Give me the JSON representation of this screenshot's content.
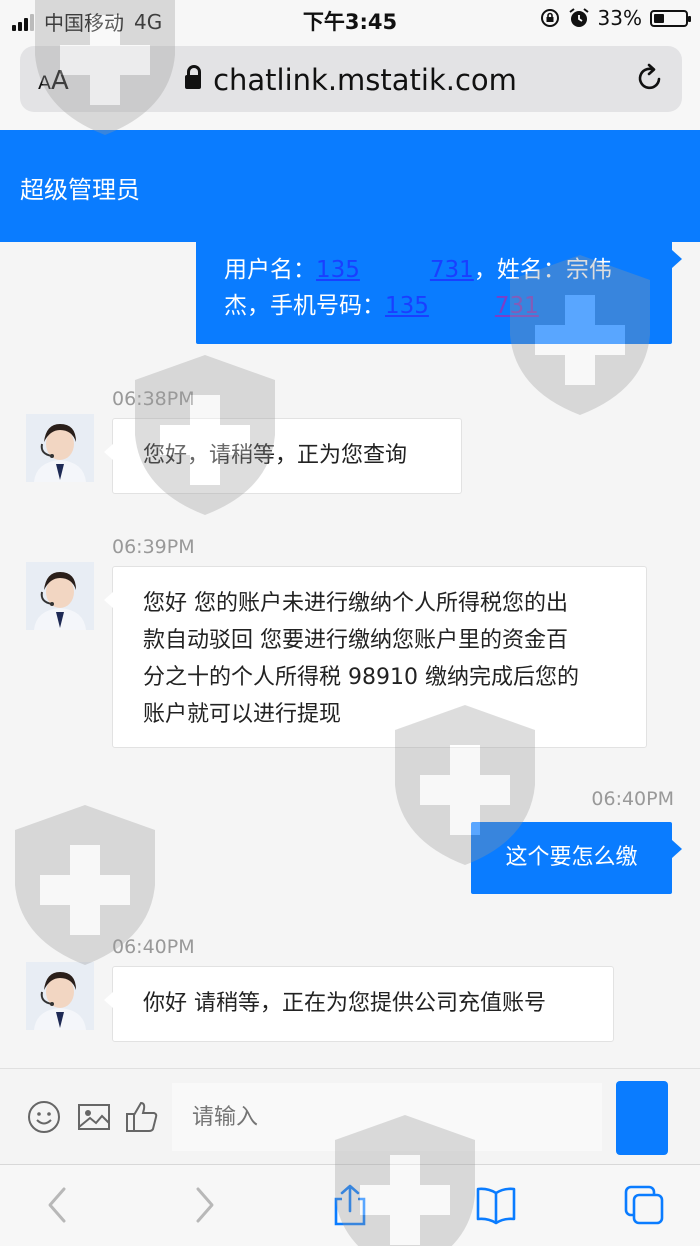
{
  "status_bar": {
    "carrier": "中国移动",
    "network": "4G",
    "time": "下午3:45",
    "battery": "33%",
    "battery_level": 0.33
  },
  "browser": {
    "aa_label": "AA",
    "url": "chatlink.mstatik.com"
  },
  "header": {
    "title": "超级管理员"
  },
  "messages": [
    {
      "side": "out",
      "line1_prefix": "用户名：",
      "line1_link": "135",
      "line1_link2": "731",
      "line1_suffix": "，姓名：宗伟",
      "line2_prefix": "杰，手机号码：",
      "line2_link": "135",
      "line2_link2": "731"
    },
    {
      "side": "in",
      "time": "06:38PM",
      "text": "您好，请稍等，正为您查询"
    },
    {
      "side": "in",
      "time": "06:39PM",
      "lines": [
        "您好 您的账户未进行缴纳个人所得税您的出",
        "款自动驳回 您要进行缴纳您账户里的资金百",
        "分之十的个人所得税 98910 缴纳完成后您的",
        "账户就可以进行提现"
      ]
    },
    {
      "side": "out",
      "time": "06:40PM",
      "text": "这个要怎么缴"
    },
    {
      "side": "in",
      "time": "06:40PM",
      "text": "你好 请稍等，正在为您提供公司充值账号"
    }
  ],
  "input": {
    "placeholder": "请输入"
  },
  "colors": {
    "accent": "#0a7cff",
    "bubble_in": "#ffffff",
    "timestamp": "#999999"
  }
}
